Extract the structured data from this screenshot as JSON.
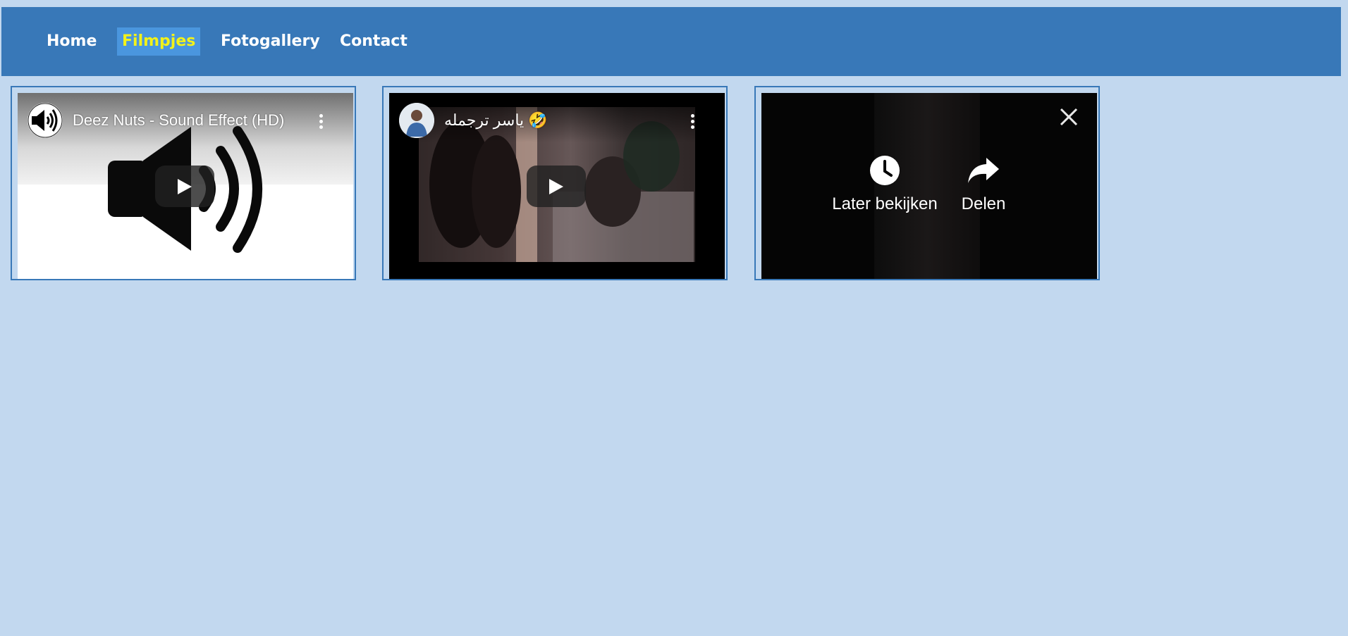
{
  "nav": {
    "items": [
      {
        "label": "Home",
        "active": false
      },
      {
        "label": "Filmpjes",
        "active": true
      },
      {
        "label": "Fotogallery",
        "active": false
      },
      {
        "label": "Contact",
        "active": false
      }
    ]
  },
  "colors": {
    "page_background": "#c2d8ef",
    "navbar": "#3878b8",
    "active_tab_background": "#4a96de",
    "active_tab_text": "#f2f21a"
  },
  "videos": [
    {
      "title": "Deez Nuts - Sound Effect (HD)",
      "avatar_icon": "speaker-icon",
      "thumbnail_icon": "speaker-icon"
    },
    {
      "title": "ياسر ترجمله 🤣",
      "avatar_icon": "person-avatar"
    },
    {
      "overlay": {
        "watch_later_label": "Later bekijken",
        "share_label": "Delen",
        "close_icon": "close-icon"
      }
    }
  ]
}
